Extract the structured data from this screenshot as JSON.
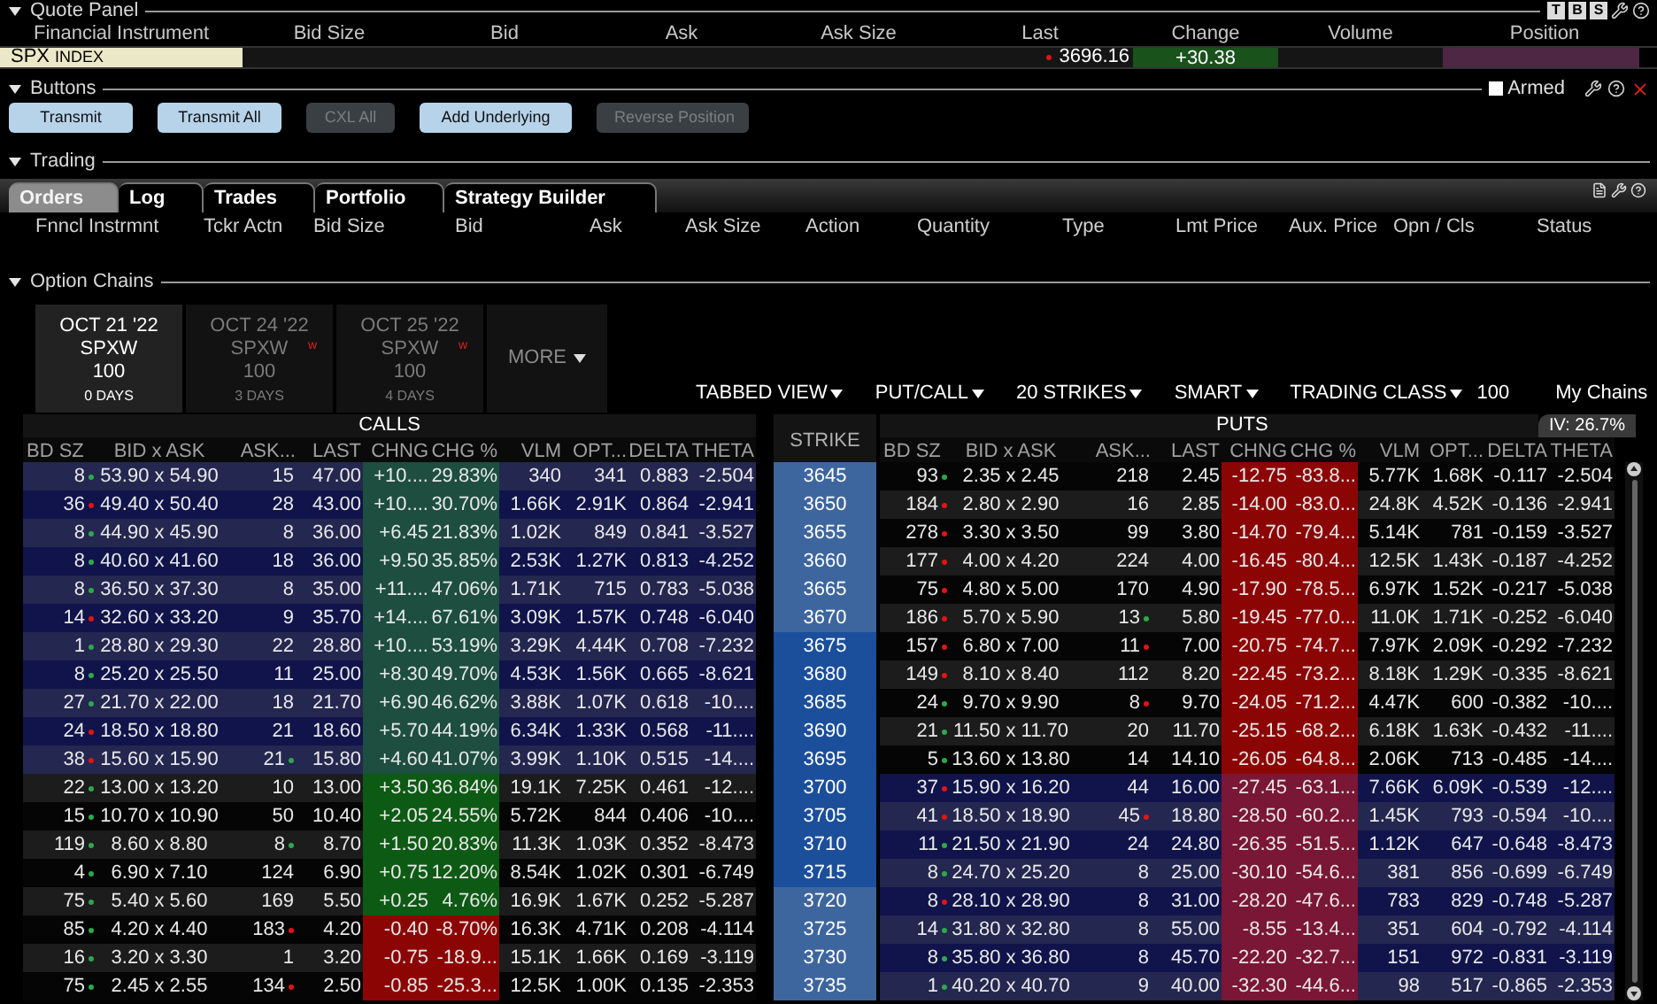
{
  "quote_panel": {
    "title": "Quote Panel",
    "tools": [
      "T",
      "B",
      "S"
    ],
    "columns": [
      "Financial Instrument",
      "Bid Size",
      "Bid",
      "Ask",
      "Ask Size",
      "Last",
      "Change",
      "Volume",
      "Position"
    ],
    "row": {
      "symbol": "SPX",
      "type": "INDEX",
      "last": "3696.16",
      "last_up": false,
      "change": "+30.38",
      "change_up": true
    }
  },
  "buttons_panel": {
    "title": "Buttons",
    "armed": {
      "label": "Armed",
      "checked": false
    },
    "buttons": [
      {
        "label": "Transmit",
        "disabled": false
      },
      {
        "label": "Transmit All",
        "disabled": false
      },
      {
        "label": "CXL All",
        "disabled": true
      },
      {
        "label": "Add Underlying",
        "disabled": false
      },
      {
        "label": "Reverse Position",
        "disabled": true
      }
    ]
  },
  "trading": {
    "title": "Trading",
    "tabs": [
      {
        "label": "Orders",
        "selected": true
      },
      {
        "label": "Log",
        "selected": false
      },
      {
        "label": "Trades",
        "selected": false
      },
      {
        "label": "Portfolio",
        "selected": false
      },
      {
        "label": "Strategy Builder",
        "selected": false
      }
    ],
    "columns": [
      "Fnncl Instrmnt",
      "Tckr Actn",
      "Bid Size",
      "Bid",
      "Ask",
      "Ask Size",
      "Action",
      "Quantity",
      "Type",
      "Lmt Price",
      "Aux. Price",
      "Opn / Cls",
      "Status"
    ]
  },
  "option_chains": {
    "title": "Option Chains",
    "expiries": [
      {
        "date": "OCT 21 '22",
        "class": "SPXW",
        "multiplier": "100",
        "days": "0 DAYS",
        "selected": true
      },
      {
        "date": "OCT 24 '22",
        "class": "SPXW",
        "multiplier": "100",
        "days": "3 DAYS",
        "selected": false,
        "flag": "w"
      },
      {
        "date": "OCT 25 '22",
        "class": "SPXW",
        "multiplier": "100",
        "days": "4 DAYS",
        "selected": false,
        "flag": "w"
      }
    ],
    "more": "MORE",
    "toolbar": [
      {
        "label": "TABBED VIEW",
        "kind": "dropdown"
      },
      {
        "label": "PUT/CALL",
        "kind": "dropdown"
      },
      {
        "label": "20 STRIKES",
        "kind": "dropdown"
      },
      {
        "label": "SMART",
        "kind": "dropdown"
      },
      {
        "label": "TRADING CLASS",
        "kind": "dropdown"
      },
      {
        "label": "100",
        "kind": "text"
      },
      {
        "label": "My Chains",
        "kind": "button"
      }
    ],
    "calls_label": "CALLS",
    "puts_label": "PUTS",
    "strike_label": "STRIKE",
    "iv": "IV: 26.7%",
    "columns": [
      "BD SZ",
      "BID x  ASK",
      "ASK...",
      "LAST",
      "CHNG",
      "CHG %",
      "VLM",
      "OPT...",
      "DELTA",
      "THETA"
    ],
    "put_columns": [
      "BD SZ",
      "BID x  ASK",
      "ASK...",
      "LAST",
      "CHNG",
      "CHG %",
      "VLM",
      "OPT...",
      "DELTA",
      "THETA"
    ],
    "rows": [
      {
        "strike": "3645",
        "highlight": false,
        "calls": {
          "itm": true,
          "bid_up": true,
          "ask_dot": false,
          "change_up": true,
          "cells": [
            "8",
            "53.90 x 54.90",
            "15",
            "47.00",
            "+10....",
            "29.83%",
            "340",
            "341",
            "0.883",
            "-2.504"
          ]
        },
        "puts": {
          "itm": false,
          "bid_up": true,
          "ask_dot": false,
          "change_up": false,
          "cells": [
            "93",
            "2.35 x 2.45",
            "218",
            "2.45",
            "-12.75",
            "-83.8...",
            "5.77K",
            "1.68K",
            "-0.117",
            "-2.504"
          ]
        }
      },
      {
        "strike": "3650",
        "highlight": false,
        "calls": {
          "itm": true,
          "bid_up": false,
          "ask_dot": false,
          "change_up": true,
          "cells": [
            "36",
            "49.40 x 50.40",
            "28",
            "43.00",
            "+10....",
            "30.70%",
            "1.66K",
            "2.91K",
            "0.864",
            "-2.941"
          ]
        },
        "puts": {
          "itm": false,
          "bid_up": false,
          "ask_dot": false,
          "change_up": false,
          "cells": [
            "184",
            "2.80 x 2.90",
            "16",
            "2.85",
            "-14.00",
            "-83.0...",
            "24.8K",
            "4.52K",
            "-0.136",
            "-2.941"
          ]
        }
      },
      {
        "strike": "3655",
        "highlight": false,
        "calls": {
          "itm": true,
          "bid_up": true,
          "ask_dot": false,
          "change_up": true,
          "cells": [
            "8",
            "44.90 x 45.90",
            "8",
            "36.00",
            "+6.45",
            "21.83%",
            "1.02K",
            "849",
            "0.841",
            "-3.527"
          ]
        },
        "puts": {
          "itm": false,
          "bid_up": false,
          "ask_dot": false,
          "change_up": false,
          "cells": [
            "278",
            "3.30 x 3.50",
            "99",
            "3.80",
            "-14.70",
            "-79.4...",
            "5.14K",
            "781",
            "-0.159",
            "-3.527"
          ]
        }
      },
      {
        "strike": "3660",
        "highlight": false,
        "calls": {
          "itm": true,
          "bid_up": true,
          "ask_dot": false,
          "change_up": true,
          "cells": [
            "8",
            "40.60 x 41.60",
            "18",
            "36.00",
            "+9.50",
            "35.85%",
            "2.53K",
            "1.27K",
            "0.813",
            "-4.252"
          ]
        },
        "puts": {
          "itm": false,
          "bid_up": false,
          "ask_dot": false,
          "change_up": false,
          "cells": [
            "177",
            "4.00 x 4.20",
            "224",
            "4.00",
            "-16.45",
            "-80.4...",
            "12.5K",
            "1.43K",
            "-0.187",
            "-4.252"
          ]
        }
      },
      {
        "strike": "3665",
        "highlight": false,
        "calls": {
          "itm": true,
          "bid_up": true,
          "ask_dot": false,
          "change_up": true,
          "cells": [
            "8",
            "36.50 x 37.30",
            "8",
            "35.00",
            "+11....",
            "47.06%",
            "1.71K",
            "715",
            "0.783",
            "-5.038"
          ]
        },
        "puts": {
          "itm": false,
          "bid_up": false,
          "ask_dot": false,
          "change_up": false,
          "cells": [
            "75",
            "4.80 x 5.00",
            "170",
            "4.90",
            "-17.90",
            "-78.5...",
            "6.97K",
            "1.52K",
            "-0.217",
            "-5.038"
          ]
        }
      },
      {
        "strike": "3670",
        "highlight": false,
        "calls": {
          "itm": true,
          "bid_up": false,
          "ask_dot": false,
          "change_up": true,
          "cells": [
            "14",
            "32.60 x 33.20",
            "9",
            "35.70",
            "+14....",
            "67.61%",
            "3.09K",
            "1.57K",
            "0.748",
            "-6.040"
          ]
        },
        "puts": {
          "itm": false,
          "bid_up": false,
          "ask_dot": true,
          "ask_up": true,
          "change_up": false,
          "cells": [
            "186",
            "5.70 x 5.90",
            "13",
            "5.80",
            "-19.45",
            "-77.0...",
            "11.0K",
            "1.71K",
            "-0.252",
            "-6.040"
          ]
        }
      },
      {
        "strike": "3675",
        "highlight": true,
        "calls": {
          "itm": true,
          "bid_up": true,
          "ask_dot": false,
          "change_up": true,
          "cells": [
            "1",
            "28.80 x 29.30",
            "22",
            "28.80",
            "+10....",
            "53.19%",
            "3.29K",
            "4.44K",
            "0.708",
            "-7.232"
          ]
        },
        "puts": {
          "itm": false,
          "bid_up": false,
          "ask_dot": true,
          "ask_up": false,
          "change_up": false,
          "cells": [
            "157",
            "6.80 x 7.00",
            "11",
            "7.00",
            "-20.75",
            "-74.7...",
            "7.97K",
            "2.09K",
            "-0.292",
            "-7.232"
          ]
        }
      },
      {
        "strike": "3680",
        "highlight": true,
        "calls": {
          "itm": true,
          "bid_up": true,
          "ask_dot": false,
          "change_up": true,
          "cells": [
            "8",
            "25.20 x 25.50",
            "11",
            "25.00",
            "+8.30",
            "49.70%",
            "4.53K",
            "1.56K",
            "0.665",
            "-8.621"
          ]
        },
        "puts": {
          "itm": false,
          "bid_up": false,
          "ask_dot": false,
          "change_up": false,
          "cells": [
            "149",
            "8.10 x 8.40",
            "112",
            "8.20",
            "-22.45",
            "-73.2...",
            "8.18K",
            "1.29K",
            "-0.335",
            "-8.621"
          ]
        }
      },
      {
        "strike": "3685",
        "highlight": true,
        "calls": {
          "itm": true,
          "bid_up": true,
          "ask_dot": false,
          "change_up": true,
          "cells": [
            "27",
            "21.70 x 22.00",
            "18",
            "21.70",
            "+6.90",
            "46.62%",
            "3.88K",
            "1.07K",
            "0.618",
            "-10...."
          ]
        },
        "puts": {
          "itm": false,
          "bid_up": true,
          "ask_dot": true,
          "ask_up": false,
          "change_up": false,
          "cells": [
            "24",
            "9.70 x 9.90",
            "8",
            "9.70",
            "-24.05",
            "-71.2...",
            "4.47K",
            "600",
            "-0.382",
            "-10...."
          ]
        }
      },
      {
        "strike": "3690",
        "highlight": true,
        "calls": {
          "itm": true,
          "bid_up": false,
          "ask_dot": false,
          "change_up": true,
          "cells": [
            "24",
            "18.50 x 18.80",
            "21",
            "18.60",
            "+5.70",
            "44.19%",
            "6.34K",
            "1.33K",
            "0.568",
            "-11...."
          ]
        },
        "puts": {
          "itm": false,
          "bid_up": true,
          "ask_dot": false,
          "change_up": false,
          "cells": [
            "21",
            "11.50 x 11.70",
            "20",
            "11.70",
            "-25.15",
            "-68.2...",
            "6.18K",
            "1.63K",
            "-0.432",
            "-11...."
          ]
        }
      },
      {
        "strike": "3695",
        "highlight": true,
        "calls": {
          "itm": true,
          "bid_up": false,
          "ask_dot": true,
          "ask_up": true,
          "change_up": true,
          "cells": [
            "38",
            "15.60 x 15.90",
            "21",
            "15.80",
            "+4.60",
            "41.07%",
            "3.99K",
            "1.10K",
            "0.515",
            "-14...."
          ]
        },
        "puts": {
          "itm": false,
          "bid_up": true,
          "ask_dot": false,
          "change_up": false,
          "cells": [
            "5",
            "13.60 x 13.80",
            "14",
            "14.10",
            "-26.05",
            "-64.8...",
            "2.06K",
            "713",
            "-0.485",
            "-14...."
          ]
        }
      },
      {
        "strike": "3700",
        "highlight": true,
        "calls": {
          "itm": false,
          "bid_up": true,
          "ask_dot": false,
          "change_up": true,
          "cells": [
            "22",
            "13.00 x 13.20",
            "10",
            "13.00",
            "+3.50",
            "36.84%",
            "19.1K",
            "7.25K",
            "0.461",
            "-12...."
          ]
        },
        "puts": {
          "itm": true,
          "bid_up": false,
          "ask_dot": false,
          "change_up": false,
          "cells": [
            "37",
            "15.90 x 16.20",
            "44",
            "16.00",
            "-27.45",
            "-63.1...",
            "7.66K",
            "6.09K",
            "-0.539",
            "-12...."
          ]
        }
      },
      {
        "strike": "3705",
        "highlight": true,
        "calls": {
          "itm": false,
          "bid_up": true,
          "ask_dot": false,
          "change_up": true,
          "cells": [
            "15",
            "10.70 x 10.90",
            "50",
            "10.40",
            "+2.05",
            "24.55%",
            "5.72K",
            "844",
            "0.406",
            "-10...."
          ]
        },
        "puts": {
          "itm": true,
          "bid_up": false,
          "ask_dot": true,
          "ask_up": false,
          "change_up": false,
          "cells": [
            "41",
            "18.50 x 18.90",
            "45",
            "18.80",
            "-28.50",
            "-60.2...",
            "1.45K",
            "793",
            "-0.594",
            "-10...."
          ]
        }
      },
      {
        "strike": "3710",
        "highlight": true,
        "calls": {
          "itm": false,
          "bid_up": true,
          "ask_dot": true,
          "ask_up": true,
          "change_up": true,
          "cells": [
            "119",
            "8.60 x 8.80",
            "8",
            "8.70",
            "+1.50",
            "20.83%",
            "11.3K",
            "1.03K",
            "0.352",
            "-8.473"
          ]
        },
        "puts": {
          "itm": true,
          "bid_up": true,
          "ask_dot": false,
          "change_up": false,
          "cells": [
            "11",
            "21.50 x 21.90",
            "24",
            "24.80",
            "-26.35",
            "-51.5...",
            "1.12K",
            "647",
            "-0.648",
            "-8.473"
          ]
        }
      },
      {
        "strike": "3715",
        "highlight": true,
        "calls": {
          "itm": false,
          "bid_up": true,
          "ask_dot": false,
          "change_up": true,
          "cells": [
            "4",
            "6.90 x 7.10",
            "124",
            "6.90",
            "+0.75",
            "12.20%",
            "8.54K",
            "1.02K",
            "0.301",
            "-6.749"
          ]
        },
        "puts": {
          "itm": true,
          "bid_up": true,
          "ask_dot": false,
          "change_up": false,
          "cells": [
            "8",
            "24.70 x 25.20",
            "8",
            "25.00",
            "-30.10",
            "-54.6...",
            "381",
            "856",
            "-0.699",
            "-6.749"
          ]
        }
      },
      {
        "strike": "3720",
        "highlight": false,
        "calls": {
          "itm": false,
          "bid_up": true,
          "ask_dot": false,
          "change_up": true,
          "cells": [
            "75",
            "5.40 x 5.60",
            "169",
            "5.50",
            "+0.25",
            "4.76%",
            "16.9K",
            "1.67K",
            "0.252",
            "-5.287"
          ]
        },
        "puts": {
          "itm": true,
          "bid_up": false,
          "ask_dot": false,
          "change_up": false,
          "cells": [
            "8",
            "28.10 x 28.90",
            "8",
            "31.00",
            "-28.20",
            "-47.6...",
            "783",
            "829",
            "-0.748",
            "-5.287"
          ]
        }
      },
      {
        "strike": "3725",
        "highlight": false,
        "calls": {
          "itm": false,
          "bid_up": true,
          "ask_dot": true,
          "ask_up": false,
          "change_up": false,
          "cells": [
            "85",
            "4.20 x 4.40",
            "183",
            "4.20",
            "-0.40",
            "-8.70%",
            "16.3K",
            "4.71K",
            "0.208",
            "-4.114"
          ]
        },
        "puts": {
          "itm": true,
          "bid_up": true,
          "ask_dot": false,
          "change_up": false,
          "cells": [
            "14",
            "31.80 x 32.80",
            "8",
            "55.00",
            "-8.55",
            "-13.4...",
            "351",
            "604",
            "-0.792",
            "-4.114"
          ]
        }
      },
      {
        "strike": "3730",
        "highlight": false,
        "calls": {
          "itm": false,
          "bid_up": true,
          "ask_dot": false,
          "change_up": false,
          "cells": [
            "16",
            "3.20 x 3.30",
            "1",
            "3.20",
            "-0.75",
            "-18.9...",
            "15.1K",
            "1.66K",
            "0.169",
            "-3.119"
          ]
        },
        "puts": {
          "itm": true,
          "bid_up": true,
          "ask_dot": false,
          "change_up": false,
          "cells": [
            "8",
            "35.80 x 36.80",
            "8",
            "45.70",
            "-22.20",
            "-32.7...",
            "151",
            "972",
            "-0.831",
            "-3.119"
          ]
        }
      },
      {
        "strike": "3735",
        "highlight": false,
        "calls": {
          "itm": false,
          "bid_up": true,
          "ask_dot": true,
          "ask_up": false,
          "change_up": false,
          "cells": [
            "75",
            "2.45 x 2.55",
            "134",
            "2.50",
            "-0.85",
            "-25.3...",
            "12.5K",
            "1.00K",
            "0.135",
            "-2.353"
          ]
        },
        "puts": {
          "itm": true,
          "bid_up": true,
          "ask_dot": false,
          "change_up": false,
          "cells": [
            "1",
            "40.20 x 40.70",
            "9",
            "40.00",
            "-32.30",
            "-44.6...",
            "98",
            "517",
            "-0.865",
            "-2.353"
          ]
        }
      }
    ]
  }
}
